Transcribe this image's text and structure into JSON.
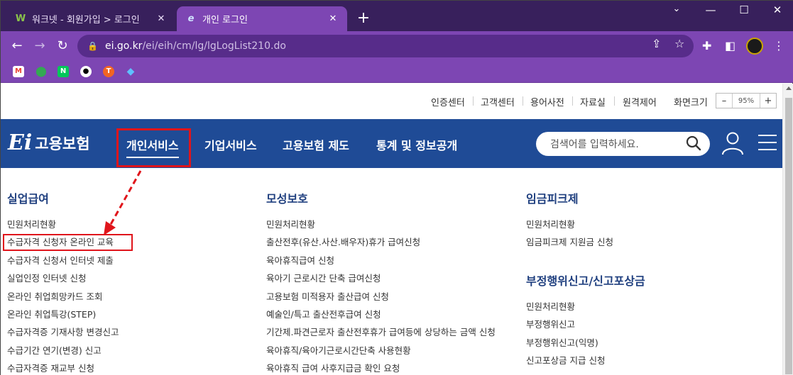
{
  "browser": {
    "tabs": [
      {
        "title": "워크넷 - 회원가입 > 로그인",
        "favicon": "W",
        "active": false
      },
      {
        "title": "개인 로그인",
        "favicon": "e",
        "active": true
      }
    ],
    "url_host": "ei.go.kr",
    "url_path": "/ei/eih/cm/lg/lgLogList210.do",
    "bookmarks": [
      {
        "icon": "gmail-icon",
        "label": "M",
        "color": "#ea4335"
      },
      {
        "icon": "maps-icon",
        "label": "",
        "color": "#34a853"
      },
      {
        "icon": "naver-icon",
        "label": "N",
        "color": "#03c75a"
      },
      {
        "icon": "panda-icon",
        "label": "",
        "color": "#ffffff"
      },
      {
        "icon": "t-icon",
        "label": "T",
        "color": "#f26522"
      },
      {
        "icon": "diamond-icon",
        "label": "",
        "color": "#3fa9f5"
      }
    ]
  },
  "util": {
    "links": [
      "인증센터",
      "고객센터",
      "용어사전",
      "자료실",
      "원격제어"
    ],
    "zoom_label": "화면크기",
    "zoom_minus": "–",
    "zoom_value": "95%",
    "zoom_plus": "+"
  },
  "gnb": {
    "logo_text": "고용보험",
    "menus": [
      "개인서비스",
      "기업서비스",
      "고용보험 제도",
      "통계 및 정보공개"
    ],
    "search_placeholder": "검색어를 입력하세요.",
    "brand_color": "#1f4b96",
    "highlight_color": "#e0151b"
  },
  "columns": [
    {
      "heading": "실업급여",
      "items": [
        "민원처리현황",
        "수급자격 신청자 온라인 교육",
        "수급자격 신청서 인터넷 제출",
        "실업인정 인터넷 신청",
        "온라인 취업희망카드 조회",
        "온라인 취업특강(STEP)",
        "수급자격증 기재사항 변경신고",
        "수급기간 연기(변경) 신고",
        "수급자격증 재교부 신청"
      ]
    },
    {
      "heading": "모성보호",
      "items": [
        "민원처리현황",
        "출산전후(유산.사산.배우자)휴가 급여신청",
        "육아휴직급여 신청",
        "육아기 근로시간 단축 급여신청",
        "고용보험 미적용자 출산급여 신청",
        "예술인/특고 출산전후급여 신청",
        "기간제.파견근로자 출산전후휴가 급여등에 상당하는 금액 신청",
        "육아휴직/육아기근로시간단축 사용현황",
        "육아휴직 급여 사후지급금 확인 요청"
      ]
    },
    {
      "heading": "임금피크제",
      "items": [
        "민원처리현황",
        "임금피크제 지원금 신청"
      ],
      "sub_heading": "부정행위신고/신고포상금",
      "sub_items": [
        "민원처리현황",
        "부정행위신고",
        "부정행위신고(익명)",
        "신고포상금 지급 신청"
      ]
    }
  ]
}
